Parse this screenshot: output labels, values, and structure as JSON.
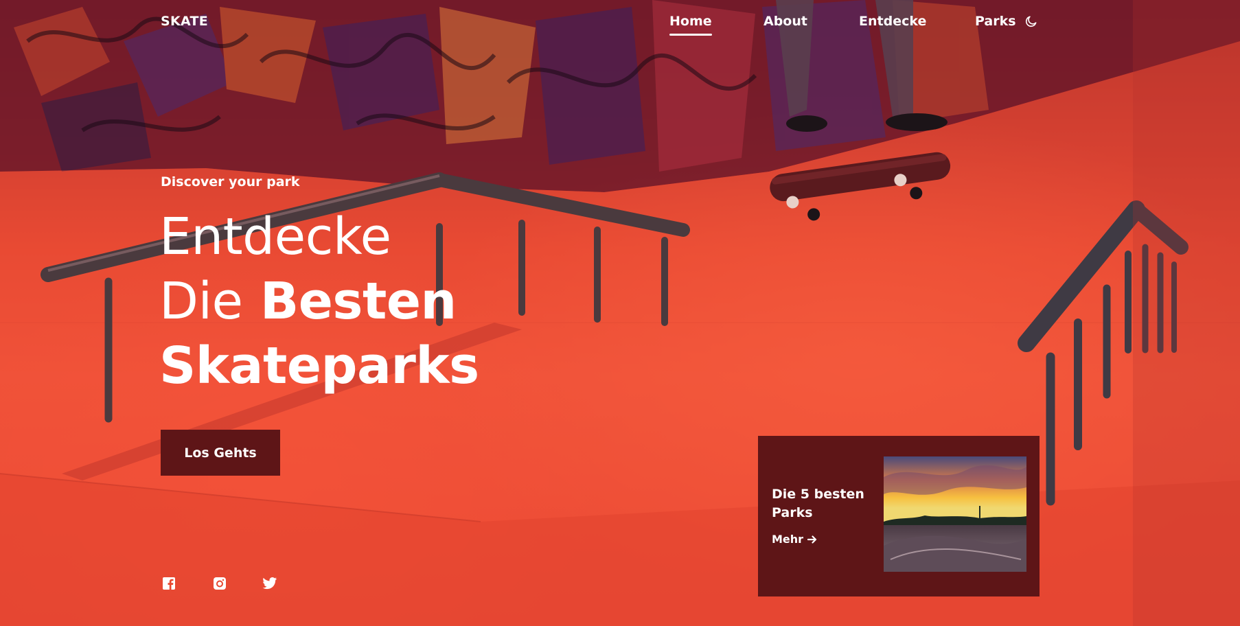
{
  "header": {
    "logo": "SKATE",
    "nav": [
      {
        "label": "Home",
        "active": true
      },
      {
        "label": "About",
        "active": false
      },
      {
        "label": "Entdecke",
        "active": false
      },
      {
        "label": "Parks",
        "active": false
      }
    ],
    "theme_toggle_icon": "moon-icon"
  },
  "hero": {
    "subtitle": "Discover your park",
    "title_line1": "Entdecke",
    "title_line2_light": "Die",
    "title_line2_bold": "Besten",
    "title_line3": "Skateparks",
    "cta_label": "Los Gehts"
  },
  "social": {
    "icons": [
      "facebook-icon",
      "instagram-icon",
      "twitter-icon"
    ]
  },
  "card": {
    "title": "Die 5 besten Parks",
    "link_label": "Mehr",
    "link_icon": "arrow-right-icon"
  },
  "colors": {
    "accent_dark": "#5e1517",
    "hero_tint": "#ec4c35",
    "text": "#ffffff"
  }
}
